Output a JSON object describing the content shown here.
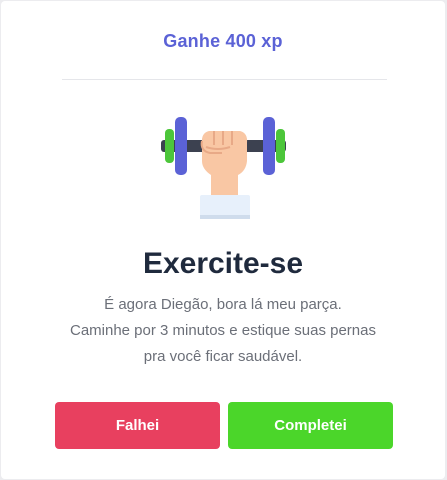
{
  "reward": {
    "label": "Ganhe 400 xp"
  },
  "task": {
    "icon": "dumbbell-hand-icon",
    "title": "Exercite-se",
    "message_lines": [
      "É agora Diegão, bora lá meu parça.",
      "Caminhe por 3 minutos e estique suas pernas",
      "pra você ficar saudável."
    ]
  },
  "actions": {
    "fail_label": "Falhei",
    "complete_label": "Completei"
  },
  "colors": {
    "accent": "#5b62d6",
    "fail": "#e8405f",
    "complete": "#4bd62a",
    "title": "#1f2a3d"
  }
}
